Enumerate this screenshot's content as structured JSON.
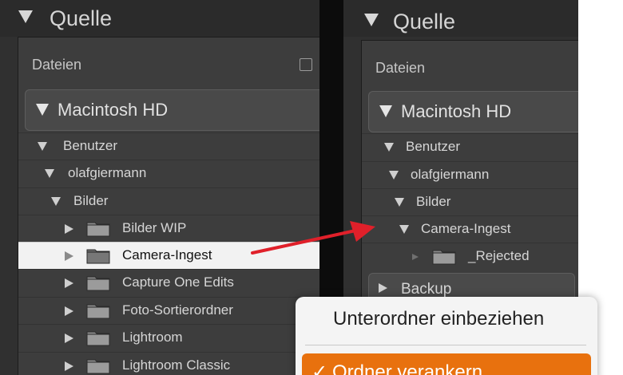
{
  "left": {
    "section_title": "Quelle",
    "files_label": "Dateien",
    "volume": "Macintosh HD",
    "rows": [
      {
        "label": "Benutzer"
      },
      {
        "label": "olafgiermann"
      },
      {
        "label": "Bilder"
      },
      {
        "label": "Bilder WIP"
      },
      {
        "label": "Camera-Ingest"
      },
      {
        "label": "Capture One Edits"
      },
      {
        "label": "Foto-Sortierordner"
      },
      {
        "label": "Lightroom"
      },
      {
        "label": "Lightroom Classic"
      }
    ]
  },
  "right": {
    "section_title": "Quelle",
    "files_label": "Dateien",
    "volume": "Macintosh HD",
    "rows": [
      {
        "label": "Benutzer"
      },
      {
        "label": "olafgiermann"
      },
      {
        "label": "Bilder"
      },
      {
        "label": "Camera-Ingest"
      },
      {
        "label": "_Rejected"
      },
      {
        "label": "Backup"
      }
    ]
  },
  "context_menu": {
    "items": [
      {
        "label": "Unterordner einbeziehen",
        "checked": false
      },
      {
        "label": "Ordner verankern",
        "checked": true,
        "check_mark": "✓"
      }
    ]
  },
  "colors": {
    "panel_bg": "#3d3d3d",
    "selection_bg": "#f2f2f2",
    "arrow": "#e0202a",
    "menu_highlight": "#e8710e"
  }
}
